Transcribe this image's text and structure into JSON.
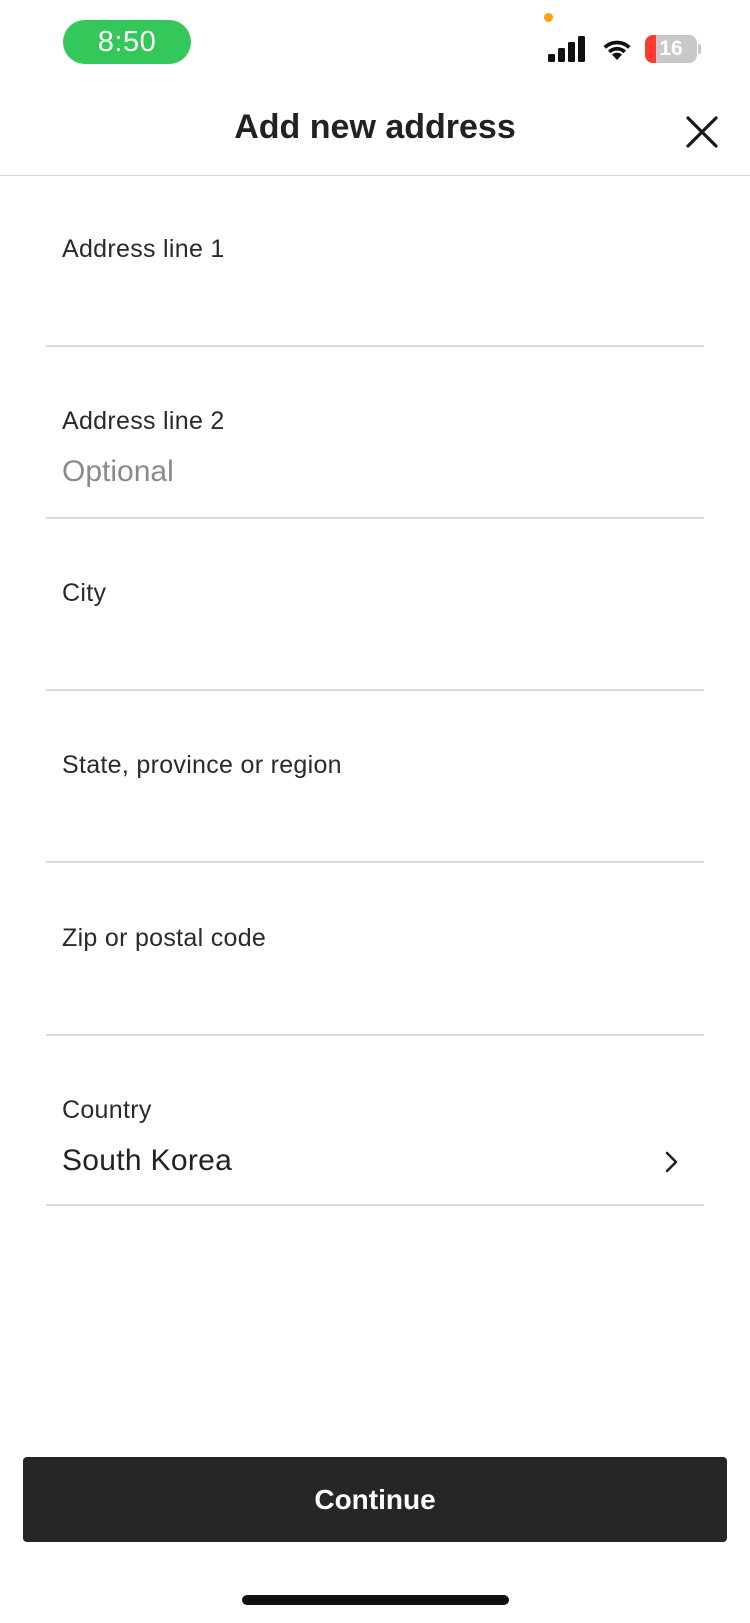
{
  "status_bar": {
    "time": "8:50",
    "battery_level": "16",
    "time_pill_color": "#34c759",
    "battery_color": "#ff3b30",
    "icons": [
      "signal-icon",
      "wifi-icon",
      "battery-icon"
    ]
  },
  "header": {
    "title": "Add new address",
    "close_icon": "close-icon"
  },
  "form": {
    "address_line_1": {
      "label": "Address line 1",
      "value": "",
      "placeholder": ""
    },
    "address_line_2": {
      "label": "Address line 2",
      "value": "",
      "placeholder": "Optional"
    },
    "city": {
      "label": "City",
      "value": "",
      "placeholder": ""
    },
    "state": {
      "label": "State, province or region",
      "value": "",
      "placeholder": ""
    },
    "zip": {
      "label": "Zip or postal code",
      "value": "",
      "placeholder": ""
    },
    "country": {
      "label": "Country",
      "value": "South Korea",
      "chevron_icon": "chevron-right-icon"
    }
  },
  "footer": {
    "continue_label": "Continue",
    "button_color": "#262626"
  }
}
